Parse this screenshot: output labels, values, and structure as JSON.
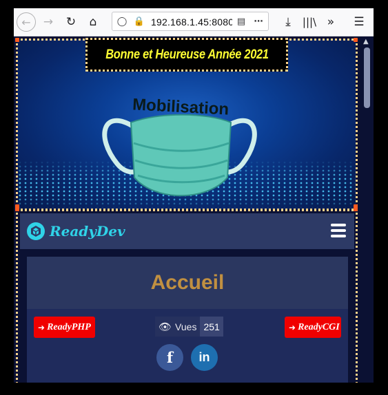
{
  "browser": {
    "url": "192.168.1.45:8080",
    "icons": [
      "back-icon",
      "forward-icon",
      "reload-icon",
      "home-icon",
      "tracking-protection-icon",
      "insecure-lock-icon",
      "reader-view-icon",
      "page-actions-icon",
      "download-icon",
      "library-icon",
      "overflow-icon",
      "menu-icon"
    ]
  },
  "banner": {
    "text": "Bonne et Heureuse Année 2021"
  },
  "hero": {
    "mask_text": "Mobilisation"
  },
  "navbar": {
    "brand": "ReadyDev"
  },
  "card": {
    "title": "Accueil",
    "left_button": "ReadyPHP",
    "right_button": "ReadyCGI",
    "views_label": "Vues",
    "views_count": "251",
    "facebook_glyph": "f",
    "linkedin_glyph": "in"
  },
  "colors": {
    "page_bg": "#0b1133",
    "navbar_bg": "#2d3a66",
    "card_bg": "#1f2b5c",
    "title_color": "#c19041",
    "button_red": "#f00000",
    "banner_text": "#ffff33",
    "brand_cyan": "#2fd3e8",
    "mask_teal": "#5fc8b8",
    "facebook_blue": "#3b5998",
    "linkedin_blue": "#1e6fb0"
  }
}
